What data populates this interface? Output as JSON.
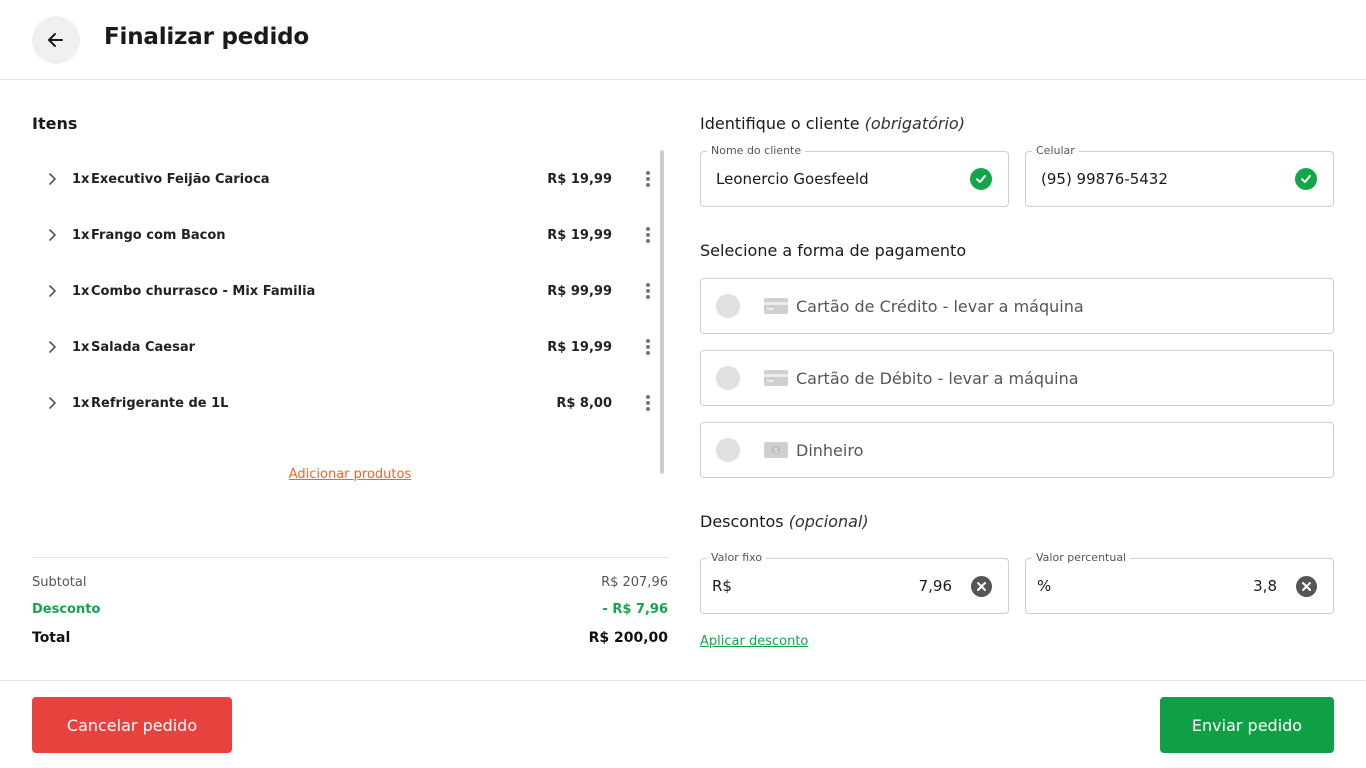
{
  "header": {
    "title": "Finalizar pedido",
    "back_icon": "arrow-left-icon"
  },
  "items_section": {
    "title": "Itens",
    "items": [
      {
        "qty": "1x",
        "name": "Executivo Feijão Carioca",
        "price": "R$ 19,99"
      },
      {
        "qty": "1x",
        "name": "Frango com Bacon",
        "price": "R$ 19,99"
      },
      {
        "qty": "1x",
        "name": "Combo churrasco - Mix Familia",
        "price": "R$ 99,99"
      },
      {
        "qty": "1x",
        "name": "Salada Caesar",
        "price": "R$ 19,99"
      },
      {
        "qty": "1x",
        "name": "Refrigerante de 1L",
        "price": "R$ 8,00"
      }
    ],
    "add_products_link": "Adicionar produtos"
  },
  "summary": {
    "subtotal_label": "Subtotal",
    "subtotal_value": "R$ 207,96",
    "discount_label": "Desconto",
    "discount_value": "- R$ 7,96",
    "total_label": "Total",
    "total_value": "R$ 200,00"
  },
  "client": {
    "title": "Identifique o cliente",
    "title_note": "(obrigatório)",
    "name_label": "Nome do cliente",
    "name_value": "Leonercio Goesfeeld",
    "phone_label": "Celular",
    "phone_value": "(95) 99876-5432"
  },
  "payment": {
    "title": "Selecione a forma de pagamento",
    "options": [
      {
        "label": "Cartão de Crédito - levar a máquina",
        "icon": "credit-card-icon"
      },
      {
        "label": "Cartão de Débito - levar a máquina",
        "icon": "credit-card-icon"
      },
      {
        "label": "Dinheiro",
        "icon": "cash-icon"
      }
    ]
  },
  "discounts": {
    "title": "Descontos",
    "title_note": "(opcional)",
    "fixed_label": "Valor fixo",
    "fixed_prefix": "R$",
    "fixed_value": "7,96",
    "percent_label": "Valor percentual",
    "percent_prefix": "%",
    "percent_value": "3,8",
    "apply_link": "Aplicar desconto"
  },
  "footer": {
    "cancel_label": "Cancelar pedido",
    "send_label": "Enviar pedido"
  },
  "colors": {
    "accent_green": "#0f9f44",
    "danger_red": "#e8413e",
    "link_orange": "#f26522"
  }
}
